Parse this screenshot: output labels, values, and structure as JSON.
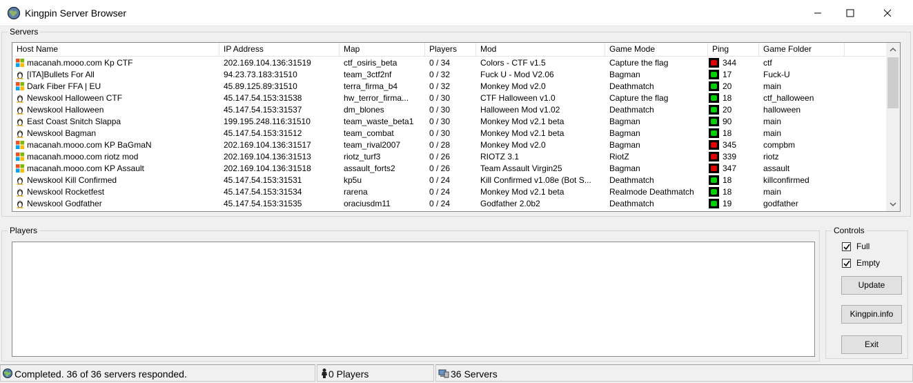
{
  "window": {
    "title": "Kingpin Server Browser",
    "app_icon": "kingpin-globe-icon",
    "controls": [
      "minimize-icon",
      "maximize-icon",
      "close-icon"
    ]
  },
  "servers_group": {
    "label": "Servers",
    "columns": [
      "Host Name",
      "IP Address",
      "Map",
      "Players",
      "Mod",
      "Game Mode",
      "Ping",
      "Game Folder"
    ],
    "rows": [
      {
        "os": "windows",
        "host": "macanah.mooo.com Kp CTF",
        "ip": "202.169.104.136:31519",
        "map": "ctf_osiris_beta",
        "players": "0 / 34",
        "mod": "Colors - CTF v1.5",
        "mode": "Capture the flag",
        "ping_status": "red",
        "ping": "344",
        "folder": "ctf"
      },
      {
        "os": "linux",
        "host": "[ITA]Bullets For All",
        "ip": "94.23.73.183:31510",
        "map": "team_3ctf2nf",
        "players": "0 / 32",
        "mod": "Fuck U - Mod V2.06",
        "mode": "Bagman",
        "ping_status": "green",
        "ping": "17",
        "folder": "Fuck-U"
      },
      {
        "os": "windows",
        "host": "Dark Fiber FFA | EU",
        "ip": "45.89.125.89:31510",
        "map": "terra_firma_b4",
        "players": "0 / 32",
        "mod": "Monkey Mod v2.0",
        "mode": "Deathmatch",
        "ping_status": "green",
        "ping": "20",
        "folder": "main"
      },
      {
        "os": "linux",
        "host": "Newskool Halloween CTF",
        "ip": "45.147.54.153:31538",
        "map": "hw_terror_firma...",
        "players": "0 / 30",
        "mod": "CTF Halloween v1.0",
        "mode": "Capture the flag",
        "ping_status": "green",
        "ping": "18",
        "folder": "ctf_halloween"
      },
      {
        "os": "linux",
        "host": "Newskool Halloween",
        "ip": "45.147.54.153:31537",
        "map": "dm_blones",
        "players": "0 / 30",
        "mod": "Halloween Mod v1.02",
        "mode": "Deathmatch",
        "ping_status": "green",
        "ping": "20",
        "folder": "halloween"
      },
      {
        "os": "linux",
        "host": "East Coast Snitch Slappa",
        "ip": "199.195.248.116:31510",
        "map": "team_waste_beta1",
        "players": "0 / 30",
        "mod": "Monkey Mod v2.1 beta",
        "mode": "Bagman",
        "ping_status": "green",
        "ping": "90",
        "folder": "main"
      },
      {
        "os": "linux",
        "host": "Newskool Bagman",
        "ip": "45.147.54.153:31512",
        "map": "team_combat",
        "players": "0 / 30",
        "mod": "Monkey Mod v2.1 beta",
        "mode": "Bagman",
        "ping_status": "green",
        "ping": "18",
        "folder": "main"
      },
      {
        "os": "windows",
        "host": "macanah.mooo.com KP BaGmaN",
        "ip": "202.169.104.136:31517",
        "map": "team_rival2007",
        "players": "0 / 28",
        "mod": "Monkey Mod v2.0",
        "mode": "Bagman",
        "ping_status": "red",
        "ping": "345",
        "folder": "compbm"
      },
      {
        "os": "windows",
        "host": "macanah.mooo.com riotz mod",
        "ip": "202.169.104.136:31513",
        "map": "riotz_turf3",
        "players": "0 / 26",
        "mod": "RIOTZ 3.1",
        "mode": "RiotZ",
        "ping_status": "red",
        "ping": "339",
        "folder": "riotz"
      },
      {
        "os": "windows",
        "host": "macanah.mooo.com KP Assault",
        "ip": "202.169.104.136:31518",
        "map": "assault_forts2",
        "players": "0 / 26",
        "mod": "Team Assault Virgin25",
        "mode": "Bagman",
        "ping_status": "red",
        "ping": "347",
        "folder": "assault"
      },
      {
        "os": "linux",
        "host": "Newskool Kill Confirmed",
        "ip": "45.147.54.153:31531",
        "map": "kp5u",
        "players": "0 / 24",
        "mod": "Kill Confirmed v1.08e (Bot S...",
        "mode": "Deathmatch",
        "ping_status": "green",
        "ping": "18",
        "folder": "killconfirmed"
      },
      {
        "os": "linux",
        "host": "Newskool Rocketfest",
        "ip": "45.147.54.153:31534",
        "map": "rarena",
        "players": "0 / 24",
        "mod": "Monkey Mod v2.1 beta",
        "mode": "Realmode Deathmatch",
        "ping_status": "green",
        "ping": "18",
        "folder": "main"
      },
      {
        "os": "linux",
        "host": "Newskool Godfather",
        "ip": "45.147.54.153:31535",
        "map": "oraciusdm11",
        "players": "0 / 24",
        "mod": "Godfather 2.0b2",
        "mode": "Deathmatch",
        "ping_status": "green",
        "ping": "19",
        "folder": "godfather"
      }
    ]
  },
  "players_group": {
    "label": "Players"
  },
  "controls_group": {
    "label": "Controls",
    "full_label": "Full",
    "full_checked": true,
    "empty_label": "Empty",
    "empty_checked": true,
    "update_label": "Update",
    "kingpin_info_label": "Kingpin.info",
    "exit_label": "Exit"
  },
  "status_bar": {
    "message": "Completed. 36 of 36 servers responded.",
    "players": "0 Players",
    "servers": "36 Servers"
  },
  "colors": {
    "ping_green": "#00d000",
    "ping_red": "#e00000",
    "list_border": "#828790"
  }
}
